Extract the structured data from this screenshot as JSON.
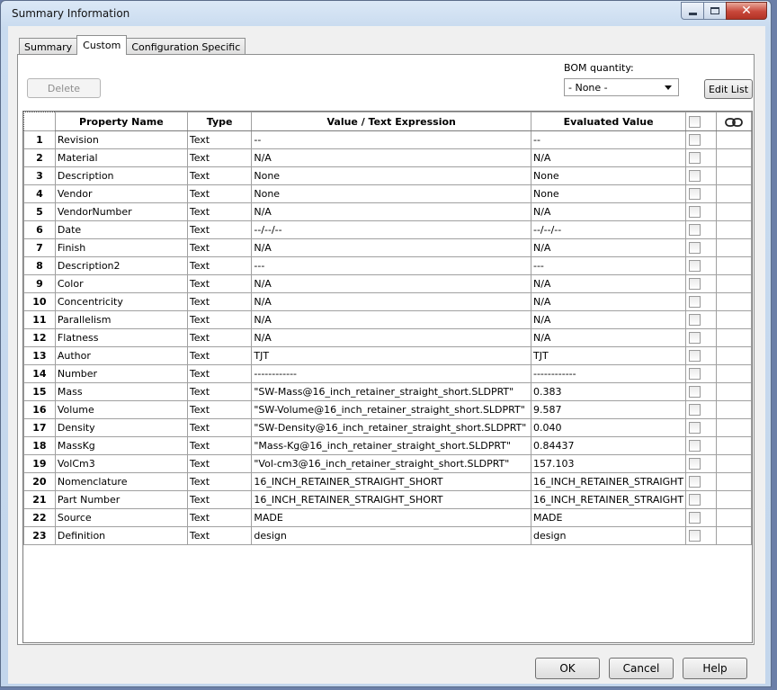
{
  "window": {
    "title": "Summary Information"
  },
  "tabs": [
    {
      "label": "Summary",
      "active": false
    },
    {
      "label": "Custom",
      "active": true
    },
    {
      "label": "Configuration Specific",
      "active": false
    }
  ],
  "toolbar": {
    "delete_label": "Delete",
    "bom_label": "BOM quantity:",
    "bom_value": "- None -",
    "edit_list_label": "Edit List"
  },
  "table": {
    "headers": {
      "property": "Property Name",
      "type": "Type",
      "value": "Value / Text Expression",
      "evaluated": "Evaluated Value"
    },
    "rows": [
      {
        "num": "1",
        "name": "Revision",
        "type": "Text",
        "value": "--",
        "evaluated": "--"
      },
      {
        "num": "2",
        "name": "Material",
        "type": "Text",
        "value": "N/A",
        "evaluated": "N/A"
      },
      {
        "num": "3",
        "name": "Description",
        "type": "Text",
        "value": "None",
        "evaluated": "None"
      },
      {
        "num": "4",
        "name": "Vendor",
        "type": "Text",
        "value": "None",
        "evaluated": "None"
      },
      {
        "num": "5",
        "name": "VendorNumber",
        "type": "Text",
        "value": "N/A",
        "evaluated": "N/A"
      },
      {
        "num": "6",
        "name": "Date",
        "type": "Text",
        "value": "--/--/--",
        "evaluated": "--/--/--"
      },
      {
        "num": "7",
        "name": "Finish",
        "type": "Text",
        "value": "N/A",
        "evaluated": "N/A"
      },
      {
        "num": "8",
        "name": "Description2",
        "type": "Text",
        "value": "---",
        "evaluated": "---"
      },
      {
        "num": "9",
        "name": "Color",
        "type": "Text",
        "value": "N/A",
        "evaluated": "N/A"
      },
      {
        "num": "10",
        "name": "Concentricity",
        "type": "Text",
        "value": "N/A",
        "evaluated": "N/A"
      },
      {
        "num": "11",
        "name": "Parallelism",
        "type": "Text",
        "value": "N/A",
        "evaluated": "N/A"
      },
      {
        "num": "12",
        "name": "Flatness",
        "type": "Text",
        "value": "N/A",
        "evaluated": "N/A"
      },
      {
        "num": "13",
        "name": "Author",
        "type": "Text",
        "value": "TJT",
        "evaluated": "TJT"
      },
      {
        "num": "14",
        "name": "Number",
        "type": "Text",
        "value": "------------",
        "evaluated": "------------"
      },
      {
        "num": "15",
        "name": "Mass",
        "type": "Text",
        "value": "\"SW-Mass@16_inch_retainer_straight_short.SLDPRT\"",
        "evaluated": "0.383"
      },
      {
        "num": "16",
        "name": "Volume",
        "type": "Text",
        "value": "\"SW-Volume@16_inch_retainer_straight_short.SLDPRT\"",
        "evaluated": "9.587"
      },
      {
        "num": "17",
        "name": "Density",
        "type": "Text",
        "value": "\"SW-Density@16_inch_retainer_straight_short.SLDPRT\"",
        "evaluated": "0.040"
      },
      {
        "num": "18",
        "name": "MassKg",
        "type": "Text",
        "value": "\"Mass-Kg@16_inch_retainer_straight_short.SLDPRT\"",
        "evaluated": "0.84437"
      },
      {
        "num": "19",
        "name": "VolCm3",
        "type": "Text",
        "value": "\"Vol-cm3@16_inch_retainer_straight_short.SLDPRT\"",
        "evaluated": "157.103"
      },
      {
        "num": "20",
        "name": "Nomenclature",
        "type": "Text",
        "value": "16_INCH_RETAINER_STRAIGHT_SHORT",
        "evaluated": "16_INCH_RETAINER_STRAIGHT"
      },
      {
        "num": "21",
        "name": "Part Number",
        "type": "Text",
        "value": "16_INCH_RETAINER_STRAIGHT_SHORT",
        "evaluated": "16_INCH_RETAINER_STRAIGHT"
      },
      {
        "num": "22",
        "name": "Source",
        "type": "Text",
        "value": "MADE",
        "evaluated": "MADE"
      },
      {
        "num": "23",
        "name": "Definition",
        "type": "Text",
        "value": "design",
        "evaluated": "design"
      }
    ]
  },
  "footer": {
    "ok_label": "OK",
    "cancel_label": "Cancel",
    "help_label": "Help"
  }
}
